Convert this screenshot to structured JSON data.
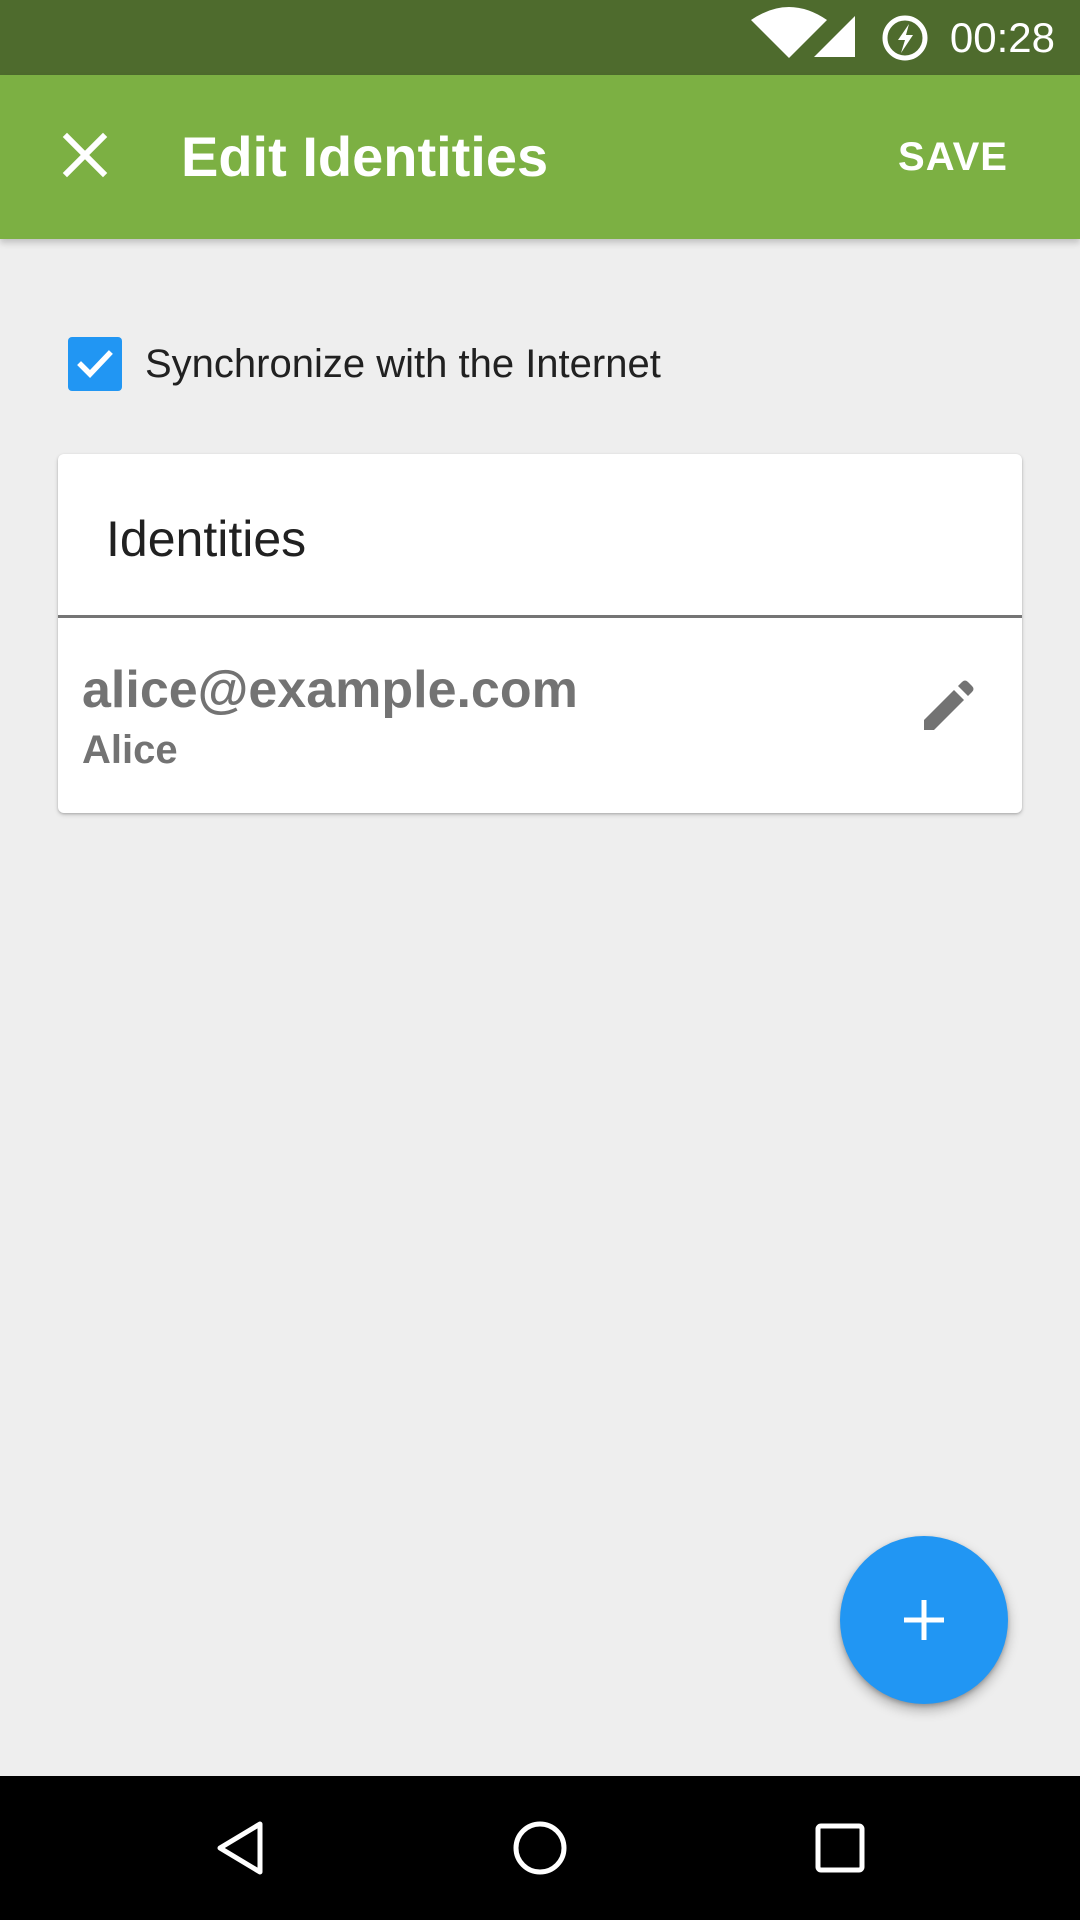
{
  "status_bar": {
    "time": "00:28",
    "icons": [
      "wifi-icon",
      "cellular-signal-icon",
      "battery-charging-icon"
    ]
  },
  "app_bar": {
    "title": "Edit Identities",
    "close_icon": "close-icon",
    "save_label": "SAVE"
  },
  "sync": {
    "label": "Synchronize with the Internet",
    "checked": true
  },
  "card": {
    "title": "Identities",
    "identities": [
      {
        "email": "alice@example.com",
        "name": "Alice",
        "edit_icon": "pencil-icon"
      }
    ]
  },
  "fab": {
    "icon": "plus-icon"
  },
  "nav_bar": {
    "icons": [
      "back-icon",
      "home-icon",
      "recents-icon"
    ]
  },
  "colors": {
    "status_bar": "#4e6b2d",
    "app_bar": "#7cb043",
    "accent": "#2196f3",
    "background": "#eeeeee",
    "identity_text": "#737373"
  }
}
